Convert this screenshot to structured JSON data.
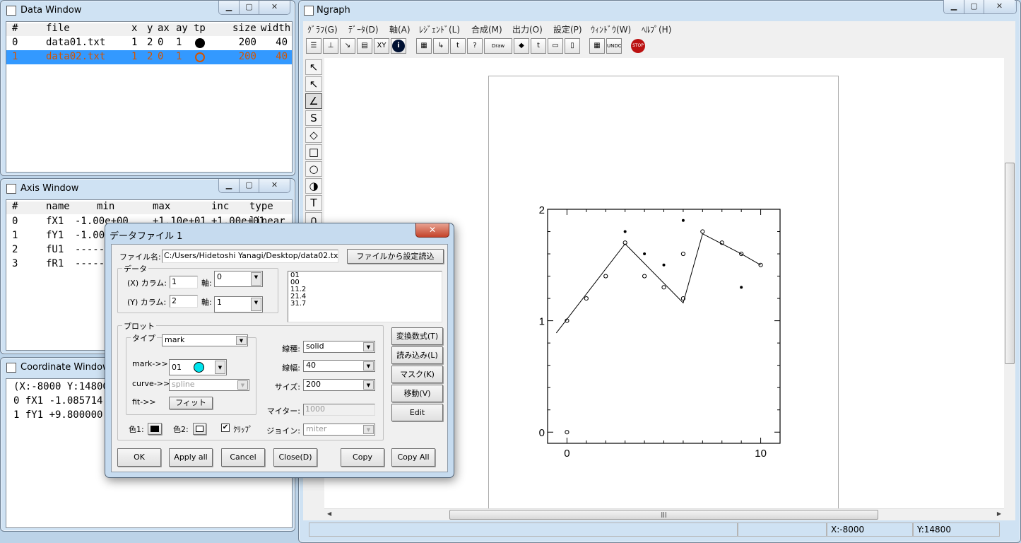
{
  "data_window": {
    "title": "Data Window",
    "headers": [
      "#",
      "file",
      "x",
      "y",
      "ax",
      "ay",
      "tp",
      "size",
      "width"
    ],
    "rows": [
      {
        "num": "0",
        "file": "data01.txt",
        "x": "1",
        "y": "2",
        "ax": "0",
        "ay": "1",
        "tp": "filled-circle",
        "size": "200",
        "width": "40",
        "selected": false
      },
      {
        "num": "1",
        "file": "data02.txt",
        "x": "1",
        "y": "2",
        "ax": "0",
        "ay": "1",
        "tp": "open-circle",
        "size": "200",
        "width": "40",
        "selected": true
      }
    ]
  },
  "axis_window": {
    "title": "Axis Window",
    "headers": [
      "#",
      "name",
      "min",
      "max",
      "inc",
      "type"
    ],
    "rows": [
      {
        "num": "0",
        "name": "fX1",
        "min": "-1.00e+00",
        "max": "+1.10e+01",
        "inc": "+1.00e+01",
        "type": "linear"
      },
      {
        "num": "1",
        "name": "fY1",
        "min": "-1.00e+00",
        "max": "",
        "inc": "",
        "type": ""
      },
      {
        "num": "2",
        "name": "fU1",
        "min": "---------",
        "max": "",
        "inc": "",
        "type": ""
      },
      {
        "num": "3",
        "name": "fR1",
        "min": "---------",
        "max": "",
        "inc": "",
        "type": ""
      }
    ]
  },
  "coord_window": {
    "title": "Coordinate Window",
    "lines": [
      "(X:-8000   Y:14800)",
      "0    fX1 -1.085714",
      "1    fY1 +9.800000"
    ]
  },
  "main": {
    "title": "Ngraph",
    "menu": [
      "ｸﾞﾗﾌ(G)",
      "ﾃﾞｰﾀ(D)",
      "軸(A)",
      "ﾚｼﾞｪﾝﾄﾞ(L)",
      "合成(M)",
      "出力(O)",
      "設定(P)",
      "ｳｨﾝﾄﾞｳ(W)",
      "ﾍﾙﾌﾟ(H)"
    ],
    "toolbar": [
      {
        "icon": "file-list-icon",
        "glyph": "☰"
      },
      {
        "icon": "axis-icon",
        "glyph": "⊥"
      },
      {
        "icon": "legend-icon",
        "glyph": "↘"
      },
      {
        "icon": "merge-icon",
        "glyph": "▤"
      },
      {
        "icon": "coordinate-icon",
        "glyph": "XY"
      },
      {
        "icon": "info-icon",
        "glyph": "i"
      },
      {
        "icon": "data-window-icon",
        "glyph": "▦"
      },
      {
        "icon": "axis-window-icon",
        "glyph": "↳"
      },
      {
        "icon": "legend-window-icon",
        "glyph": "t"
      },
      {
        "icon": "help-axis-icon",
        "glyph": "?"
      },
      {
        "icon": "draw-icon",
        "glyph": "Draw"
      },
      {
        "icon": "clear-icon",
        "glyph": "◆"
      },
      {
        "icon": "text-frame-icon",
        "glyph": "t"
      },
      {
        "icon": "print-icon",
        "glyph": "▭"
      },
      {
        "icon": "window-icon",
        "glyph": "▯"
      },
      {
        "icon": "calculator-icon",
        "glyph": "▦"
      },
      {
        "icon": "undo-icon",
        "glyph": "UNDO"
      },
      {
        "icon": "stop-icon",
        "glyph": "STOP"
      }
    ],
    "tools": [
      {
        "icon": "pointer-icon",
        "glyph": "↖"
      },
      {
        "icon": "text-pointer-icon",
        "glyph": "↖"
      },
      {
        "icon": "line-icon",
        "glyph": "∠"
      },
      {
        "icon": "curve-icon",
        "glyph": "S"
      },
      {
        "icon": "polygon-icon",
        "glyph": "◇"
      },
      {
        "icon": "rectangle-icon",
        "glyph": "□"
      },
      {
        "icon": "circle-icon",
        "glyph": "○"
      },
      {
        "icon": "mark-icon",
        "glyph": "◑"
      },
      {
        "icon": "text-icon",
        "glyph": "T"
      },
      {
        "icon": "gauss-icon",
        "glyph": "∩"
      }
    ],
    "status": {
      "x": "X:-8000",
      "y": "Y:14800"
    }
  },
  "chart_data": {
    "type": "scatter",
    "xlim": [
      -1,
      11
    ],
    "ylim": [
      -0.1,
      2
    ],
    "x_ticks": [
      "0",
      "10"
    ],
    "y_ticks": [
      "0",
      "1",
      "2"
    ],
    "series": [
      {
        "marker": "open-circle",
        "points": [
          [
            0,
            0
          ],
          [
            0,
            1
          ],
          [
            1,
            1.2
          ],
          [
            2,
            1.4
          ],
          [
            3,
            1.7
          ],
          [
            4,
            1.4
          ],
          [
            5,
            1.3
          ],
          [
            6,
            1.2
          ],
          [
            6,
            1.6
          ],
          [
            7,
            1.8
          ],
          [
            8,
            1.7
          ],
          [
            9,
            1.6
          ],
          [
            10,
            1.5
          ]
        ]
      },
      {
        "marker": "filled-dot",
        "points": [
          [
            3,
            1.8
          ],
          [
            4,
            1.6
          ],
          [
            5,
            1.5
          ],
          [
            6,
            1.9
          ],
          [
            9,
            1.3
          ]
        ]
      },
      {
        "marker": "line",
        "points": [
          [
            -0.55,
            0.89
          ],
          [
            3,
            1.69
          ],
          [
            6,
            1.16
          ],
          [
            7,
            1.78
          ],
          [
            8,
            1.69
          ],
          [
            9,
            1.6
          ],
          [
            10,
            1.5
          ]
        ]
      }
    ]
  },
  "dialog": {
    "title": "データファイル 1",
    "file_label": "ファイル名:",
    "file_value": "C:/Users/Hidetoshi Yanagi/Desktop/data02.txt",
    "load_settings": "ファイルから設定読込",
    "data_group": "データ",
    "x_col_label": "(X) カラム:",
    "x_col": "1",
    "x_axis_label": "軸:",
    "x_axis": "0",
    "y_col_label": "(Y) カラム:",
    "y_col": "2",
    "y_axis_label": "軸:",
    "y_axis": "1",
    "preview": [
      "01",
      "00",
      "11.2",
      "21.4",
      "31.7"
    ],
    "plot_group": "プロット",
    "type_label": "タイプ",
    "type": "mark",
    "mark_label": "mark->>",
    "mark": "01",
    "mark_color": "#00e5ee",
    "curve_label": "curve->>",
    "curve": "spline",
    "fit_label": "fit->>",
    "fit_button": "フィット",
    "color1_label": "色1:",
    "color1": "#000000",
    "color2_label": "色2:",
    "color2": "#ffffff",
    "clip_label": "ｸﾘｯﾌﾟ",
    "clip_checked": true,
    "line_type_label": "線種:",
    "line_type": "solid",
    "line_width_label": "線幅:",
    "line_width": "40",
    "size_label": "サイズ:",
    "size": "200",
    "miter_label": "マイター:",
    "miter": "1000",
    "join_label": "ジョイン:",
    "join": "miter",
    "side_buttons": [
      "変換数式(T)",
      "読み込み(L)",
      "マスク(K)",
      "移動(V)",
      "Edit"
    ],
    "bottom_buttons": [
      "OK",
      "Apply all",
      "Cancel",
      "Close(D)",
      "Copy",
      "Copy All"
    ]
  }
}
